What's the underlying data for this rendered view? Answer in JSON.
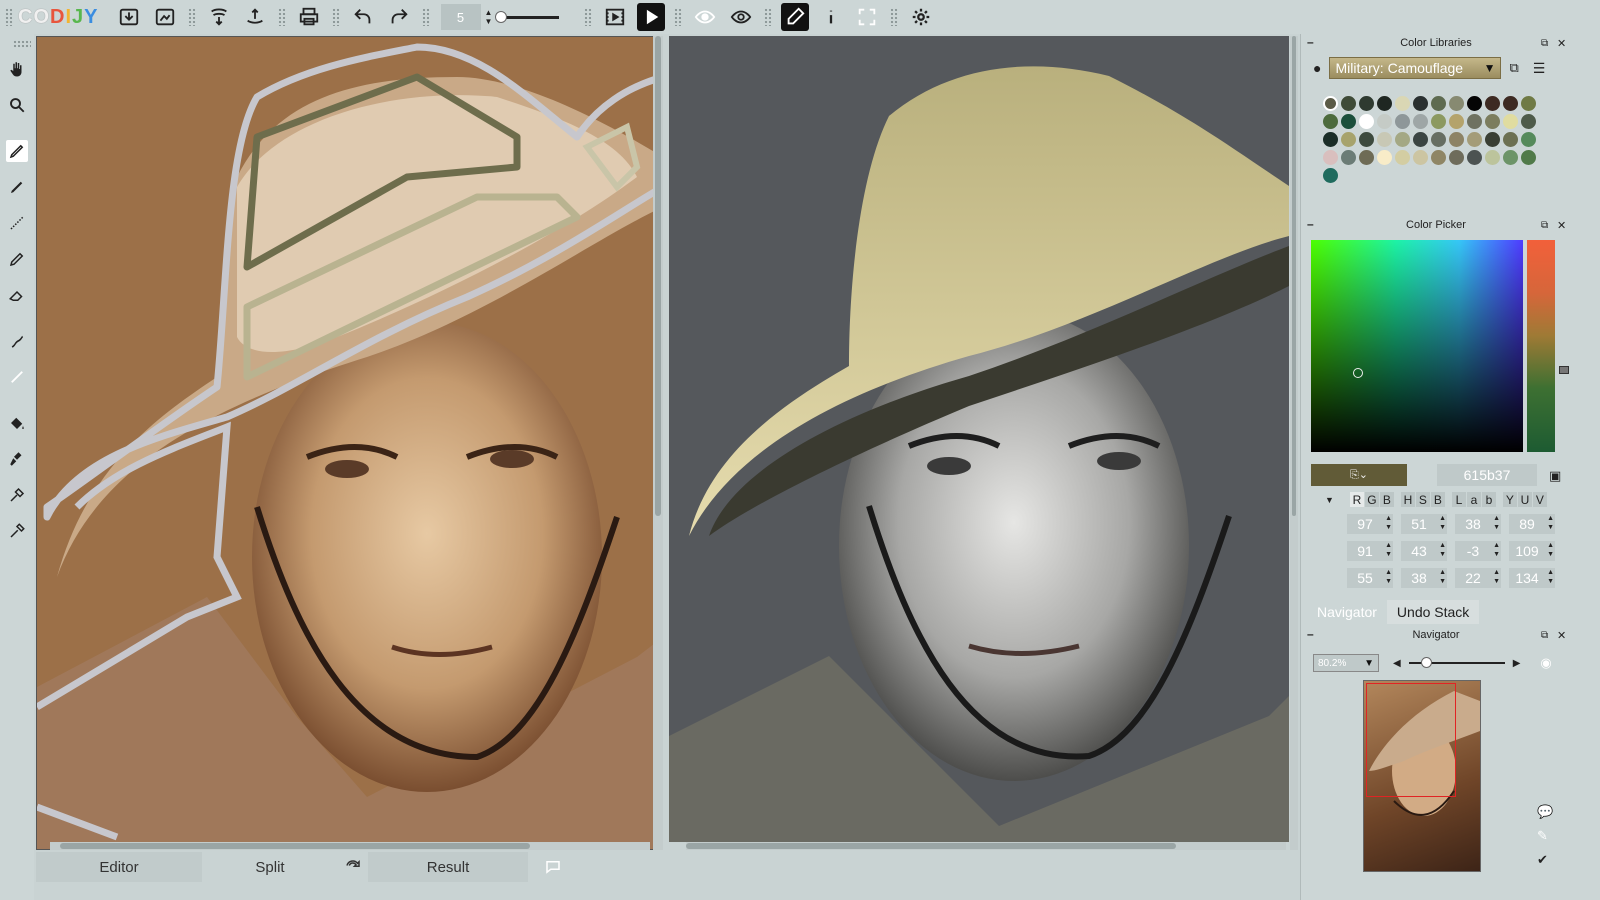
{
  "app": {
    "logo_text": "CODIJY",
    "brush_size": "5"
  },
  "bottom_tabs": {
    "editor": "Editor",
    "split": "Split",
    "result": "Result"
  },
  "color_libraries": {
    "title": "Color Libraries",
    "selected_library": "Military: Camouflage",
    "swatches": [
      "#5b5b47",
      "#3f4b37",
      "#2e3a30",
      "#1f2722",
      "#dad7b4",
      "#2a3030",
      "#5e6b50",
      "#878a71",
      "#050505",
      "#3d2a22",
      "#3d2a22",
      "#6f7a45",
      "#4d6b3d",
      "#1b4f3b",
      "#ffffff",
      "#c5cbc6",
      "#8e9799",
      "#9ea6a6",
      "#8c9960",
      "#b4a36b",
      "#6f7261",
      "#7c7d5e",
      "#e0dca0",
      "#4e5b4a",
      "#1b2e28",
      "#a7a36c",
      "#3d4a3e",
      "#c8c8b5",
      "#a4a884",
      "#3b4543",
      "#676e62",
      "#8d8365",
      "#a49c78",
      "#3a3f34",
      "#6c7052",
      "#558a5b",
      "#d9bfbe",
      "#6b7c76",
      "#6e6b55",
      "#f8ecc8",
      "#d3cda2",
      "#ccc5a2",
      "#8f8665",
      "#6e6c5b",
      "#4c5352",
      "#bcc49c",
      "#6c9468",
      "#507a49",
      "#1f6b5e"
    ]
  },
  "color_picker": {
    "title": "Color Picker",
    "current_color": "#615b37",
    "hex": "615b37",
    "modes_group1": [
      "R",
      "G",
      "B"
    ],
    "modes_group2": [
      "H",
      "S",
      "B"
    ],
    "modes_group3": [
      "L",
      "a",
      "b"
    ],
    "modes_group4": [
      "Y",
      "U",
      "V"
    ],
    "rows": [
      [
        "97",
        "51",
        "38",
        "89"
      ],
      [
        "91",
        "43",
        "-3",
        "109"
      ],
      [
        "55",
        "38",
        "22",
        "134"
      ]
    ]
  },
  "panel_tabs": {
    "navigator": "Navigator",
    "undo_stack": "Undo Stack"
  },
  "navigator": {
    "title": "Navigator",
    "zoom": "80.2%"
  }
}
